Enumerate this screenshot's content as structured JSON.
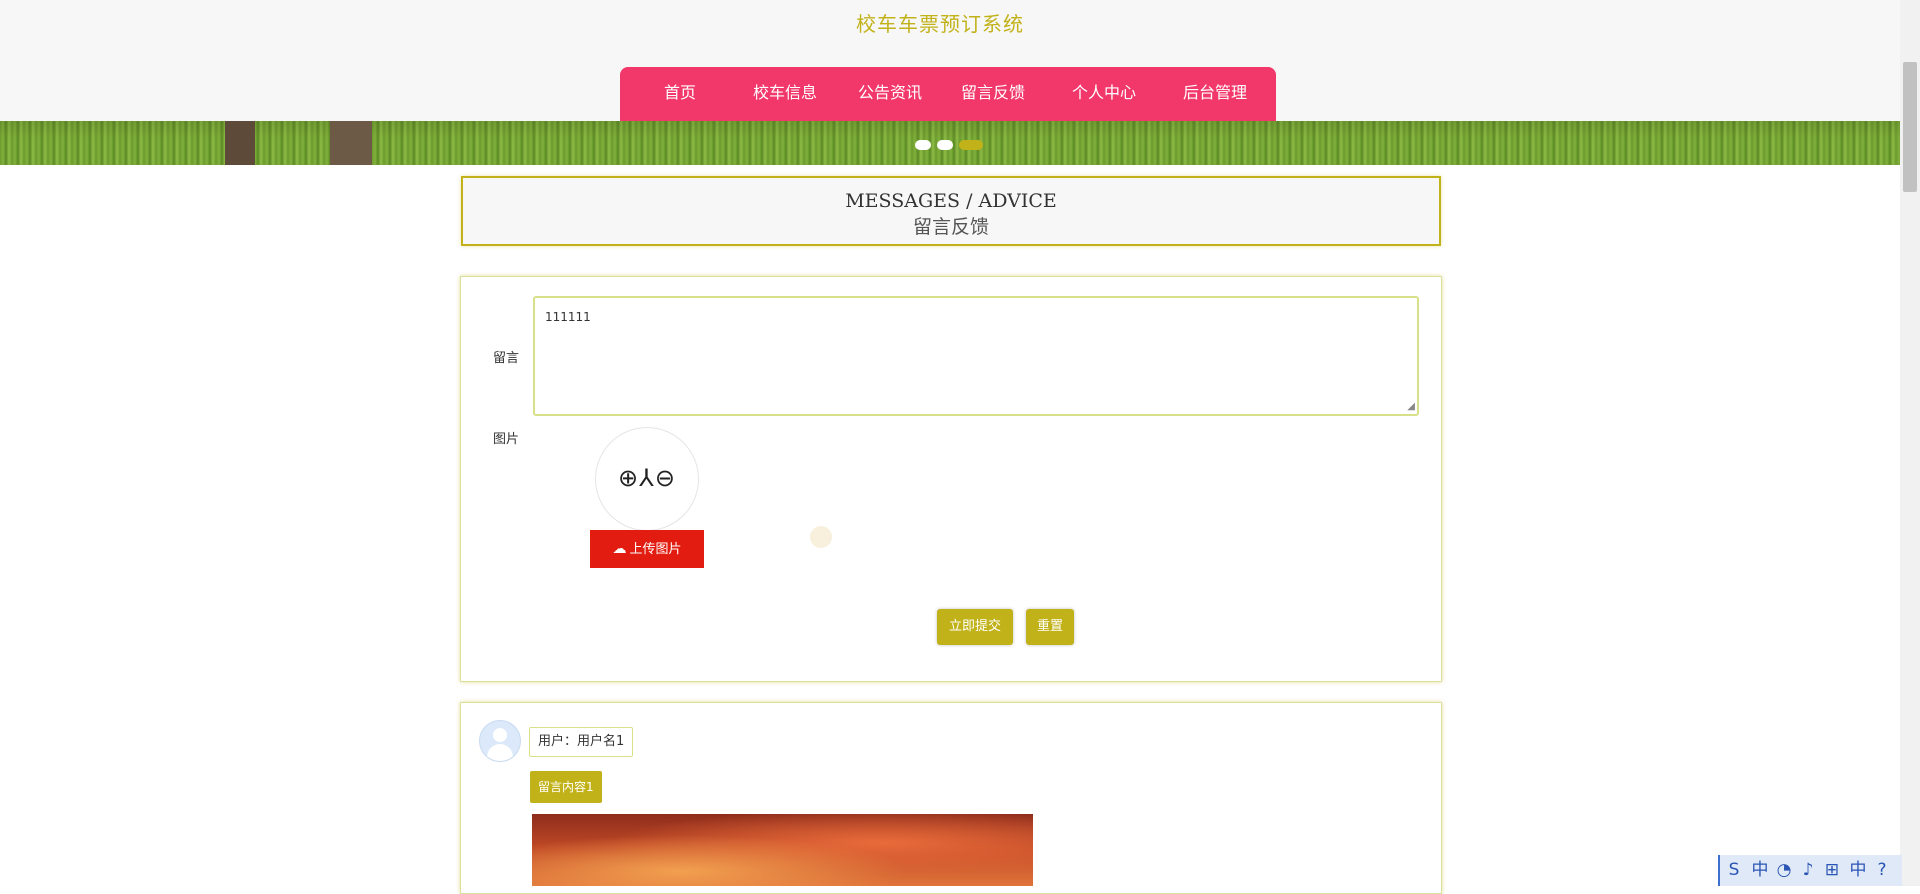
{
  "header": {
    "site_title": "校车车票预订系统",
    "nav": [
      {
        "label": "首页"
      },
      {
        "label": "校车信息"
      },
      {
        "label": "公告资讯"
      },
      {
        "label": "留言反馈"
      },
      {
        "label": "个人中心"
      },
      {
        "label": "后台管理"
      }
    ],
    "nav_color": "#f2376a",
    "accent_color": "#c2b21a"
  },
  "banner": {
    "slides": 3,
    "active_slide_index": 2
  },
  "section_title": {
    "en": "MESSAGES / ADVICE",
    "cn": "留言反馈"
  },
  "form": {
    "message_label": "留言",
    "message_value": "111111",
    "image_label": "图片",
    "image_placeholder_glyph": "⊕⅄⊖",
    "upload_button": "上传图片",
    "upload_icon": "cloud-upload-icon",
    "submit_button": "立即提交",
    "reset_button": "重置"
  },
  "messages": [
    {
      "user_label": "用户：用户名1",
      "content": "留言内容1"
    }
  ],
  "taskbar": {
    "icons": [
      "S",
      "中",
      "◔",
      "♪",
      "⊞",
      "中",
      "?"
    ]
  }
}
